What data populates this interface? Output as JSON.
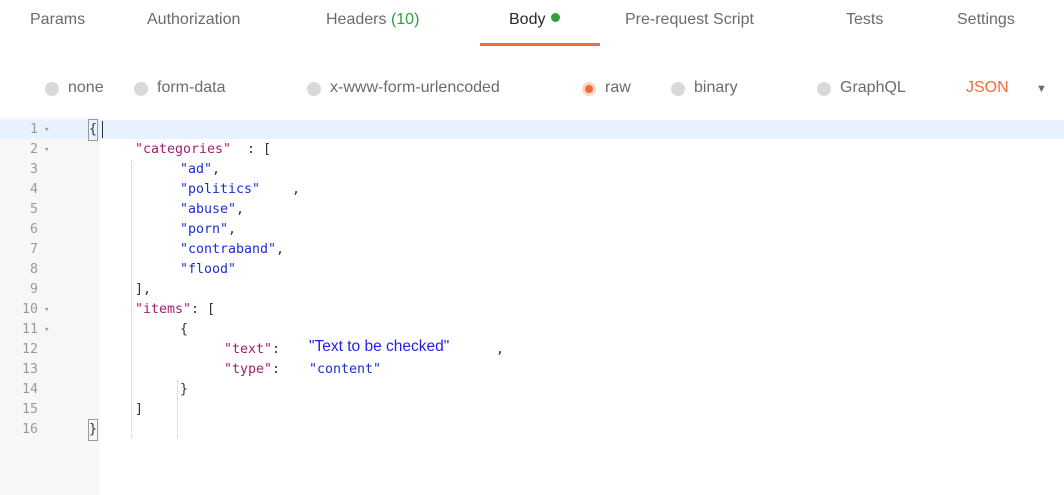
{
  "tabs": [
    {
      "label": "Params"
    },
    {
      "label": "Authorization"
    },
    {
      "label": "Headers",
      "count": "(10)"
    },
    {
      "label": "Body",
      "active": true
    },
    {
      "label": "Pre-request Script"
    },
    {
      "label": "Tests"
    },
    {
      "label": "Settings"
    }
  ],
  "body_types": [
    {
      "label": "none",
      "selected": false
    },
    {
      "label": "form-data",
      "selected": false
    },
    {
      "label": "x-www-form-urlencoded",
      "selected": false
    },
    {
      "label": "raw",
      "selected": true
    },
    {
      "label": "binary",
      "selected": false
    },
    {
      "label": "GraphQL",
      "selected": false
    }
  ],
  "format_select": {
    "value": "JSON"
  },
  "colors": {
    "accent": "#f26b3a",
    "status_green": "#2e9e3e",
    "json_key": "#a0226e",
    "json_string": "#1c2fd0"
  },
  "editor": {
    "line_numbers": [
      "1",
      "2",
      "3",
      "4",
      "5",
      "6",
      "7",
      "8",
      "9",
      "10",
      "11",
      "12",
      "13",
      "14",
      "15",
      "16"
    ],
    "tokens": {
      "l1": "{",
      "l2_key": "\"categories\"",
      "l2_rest": ": [",
      "l3": "\"ad\"",
      "l4": "\"politics\"",
      "l5": "\"abuse\"",
      "l6": "\"porn\"",
      "l7": "\"contraband\"",
      "l8": "\"flood\"",
      "l9": "],",
      "l10_key": "\"items\"",
      "l10_rest": ": [",
      "l11": "{",
      "l12_key": "\"text\"",
      "l12_colon": ": ",
      "l12_val": "\"Text to be checked\"",
      "l13_key": "\"type\"",
      "l13_colon": ": ",
      "l13_val": "\"content\"",
      "l14": "}",
      "l15": "]",
      "l16": "}",
      "comma": ","
    }
  }
}
